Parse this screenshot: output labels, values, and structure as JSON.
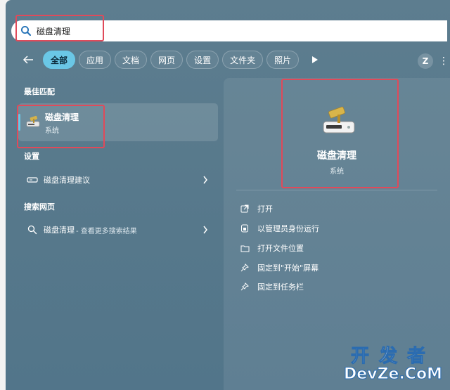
{
  "search": {
    "value": "磁盘清理",
    "placeholder": ""
  },
  "filters": [
    {
      "label": "全部",
      "active": true
    },
    {
      "label": "应用",
      "active": false
    },
    {
      "label": "文档",
      "active": false
    },
    {
      "label": "网页",
      "active": false
    },
    {
      "label": "设置",
      "active": false
    },
    {
      "label": "文件夹",
      "active": false
    },
    {
      "label": "照片",
      "active": false
    }
  ],
  "user": {
    "avatar_letter": "Z"
  },
  "more_glyph": "⋮",
  "left": {
    "best_match_heading": "最佳匹配",
    "best_match": {
      "title": "磁盘清理",
      "subtitle": "系统"
    },
    "settings_heading": "设置",
    "settings_item": {
      "label": "磁盘清理建议"
    },
    "web_heading": "搜索网页",
    "web_item": {
      "label": "磁盘清理",
      "suffix": " - 查看更多搜索结果"
    }
  },
  "detail": {
    "title": "磁盘清理",
    "subtitle": "系统",
    "actions": [
      {
        "label": "打开",
        "icon": "open-external-icon"
      },
      {
        "label": "以管理员身份运行",
        "icon": "shield-admin-icon"
      },
      {
        "label": "打开文件位置",
        "icon": "folder-icon"
      },
      {
        "label": "固定到\"开始\"屏幕",
        "icon": "pin-icon"
      },
      {
        "label": "固定到任务栏",
        "icon": "pin-icon"
      }
    ]
  },
  "watermark": {
    "top": "开发者",
    "bottom": "DevZe.CoM"
  },
  "colors": {
    "accent": "#6ac7e6",
    "highlight_box": "#e04a5a",
    "panel": "#5a7a8c"
  }
}
